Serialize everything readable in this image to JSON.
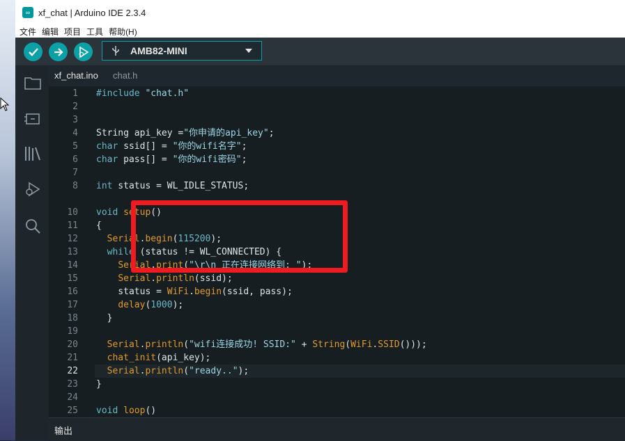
{
  "window": {
    "title": "xf_chat | Arduino IDE 2.3.4"
  },
  "menu": [
    "文件",
    "编辑",
    "项目",
    "工具",
    "帮助(H)"
  ],
  "toolbar": {
    "board": "AMB82-MINI"
  },
  "tabs": [
    {
      "label": "xf_chat.ino"
    },
    {
      "label": "chat.h"
    }
  ],
  "editor": {
    "line_numbers": [
      "1",
      "2",
      "3",
      "4",
      "5",
      "6",
      "7",
      "8",
      "10",
      "11",
      "12",
      "13",
      "14",
      "15",
      "16",
      "17",
      "18",
      "19",
      "20",
      "21",
      "22",
      "23",
      "24",
      "25"
    ],
    "current_line": "22"
  },
  "output": {
    "label": "输出"
  },
  "colors": {
    "accent": "#0ca1a6",
    "highlight_box": "#ee1b20"
  },
  "icons": {
    "verify": "check-icon",
    "upload": "arrow-right-icon",
    "debug": "debug-play-icon",
    "usb": "usb-icon",
    "sketchbook": "folder-icon",
    "boards": "board-manager-icon",
    "library": "library-icon",
    "debugger": "debug-icon",
    "search": "search-icon"
  }
}
